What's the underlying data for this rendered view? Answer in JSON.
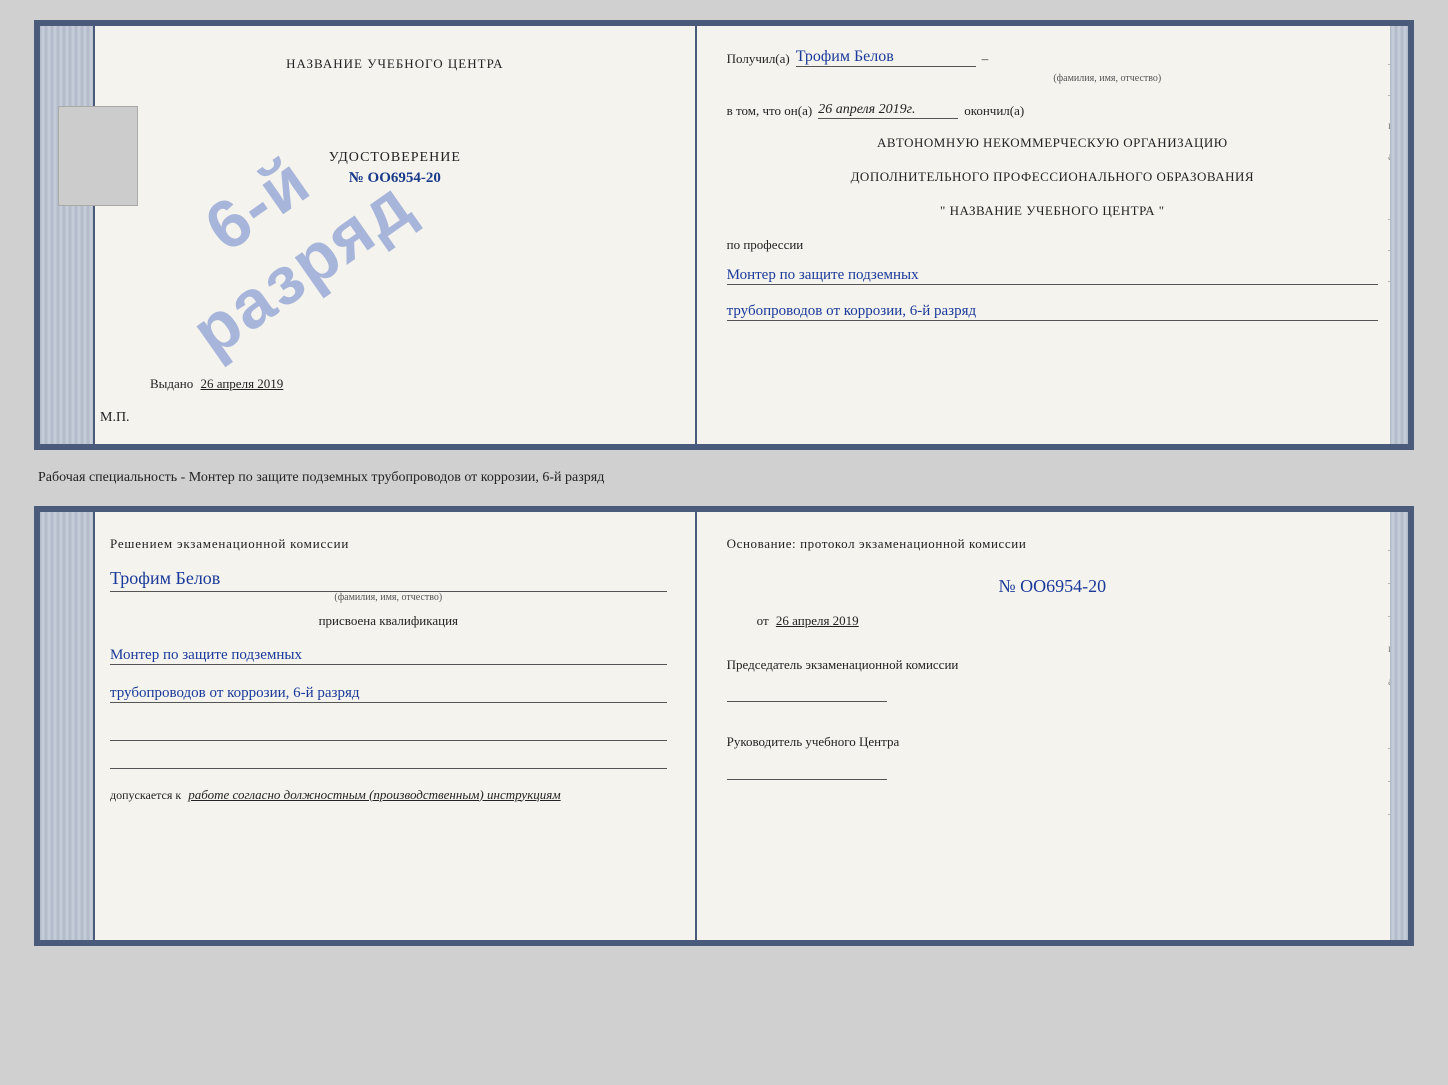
{
  "top_cert": {
    "left": {
      "title": "НАЗВАНИЕ УЧЕБНОГО ЦЕНТРА",
      "photo_alt": "photo",
      "udostoverenie_title": "УДОСТОВЕРЕНИЕ",
      "udostoverenie_number": "№ OO6954-20",
      "stamp_line1": "6-й",
      "stamp_line2": "разряд",
      "vydano_label": "Выдано",
      "vydano_date": "26 апреля 2019",
      "mp_label": "М.П."
    },
    "right": {
      "poluchil_label": "Получил(а)",
      "poluchil_name": "Трофим Белов",
      "poluchil_sub": "(фамилия, имя, отчество)",
      "vtom_label": "в том, что он(а)",
      "vtom_date": "26 апреля 2019г.",
      "okonchil_label": "окончил(а)",
      "org_line1": "АВТОНОМНУЮ НЕКОММЕРЧЕСКУЮ ОРГАНИЗАЦИЮ",
      "org_line2": "ДОПОЛНИТЕЛЬНОГО ПРОФЕССИОНАЛЬНОГО ОБРАЗОВАНИЯ",
      "org_line3": "\"    НАЗВАНИЕ УЧЕБНОГО ЦЕНТРА    \"",
      "po_professii_label": "по профессии",
      "profession_line1": "Монтер по защите подземных",
      "profession_line2": "трубопроводов от коррозии, 6-й разряд",
      "side_chars": [
        "–",
        "–",
        "и",
        "а",
        "←",
        "–",
        "–",
        "–",
        "–"
      ]
    }
  },
  "middle": {
    "text": "Рабочая специальность - Монтер по защите подземных трубопроводов от коррозии, 6-й разряд"
  },
  "bottom_cert": {
    "left": {
      "resheniem_title": "Решением экзаменационной комиссии",
      "name_hw": "Трофим Белов",
      "name_sub": "(фамилия, имя, отчество)",
      "prisvoena_label": "присвоена квалификация",
      "qual_line1": "Монтер по защите подземных",
      "qual_line2": "трубопроводов от коррозии, 6-й разряд",
      "dopusk_label": "допускается к",
      "dopusk_hw": "работе согласно должностным (производственным) инструкциям"
    },
    "right": {
      "osnovanie_title": "Основание: протокол экзаменационной комиссии",
      "number_hw": "№ OO6954-20",
      "ot_label": "от",
      "ot_date": "26 апреля 2019",
      "predsed_title": "Председатель экзаменационной комиссии",
      "ruk_title": "Руководитель учебного Центра",
      "side_chars": [
        "–",
        "–",
        "–",
        "и",
        "а",
        "←",
        "–",
        "–",
        "–",
        "–"
      ]
    }
  }
}
